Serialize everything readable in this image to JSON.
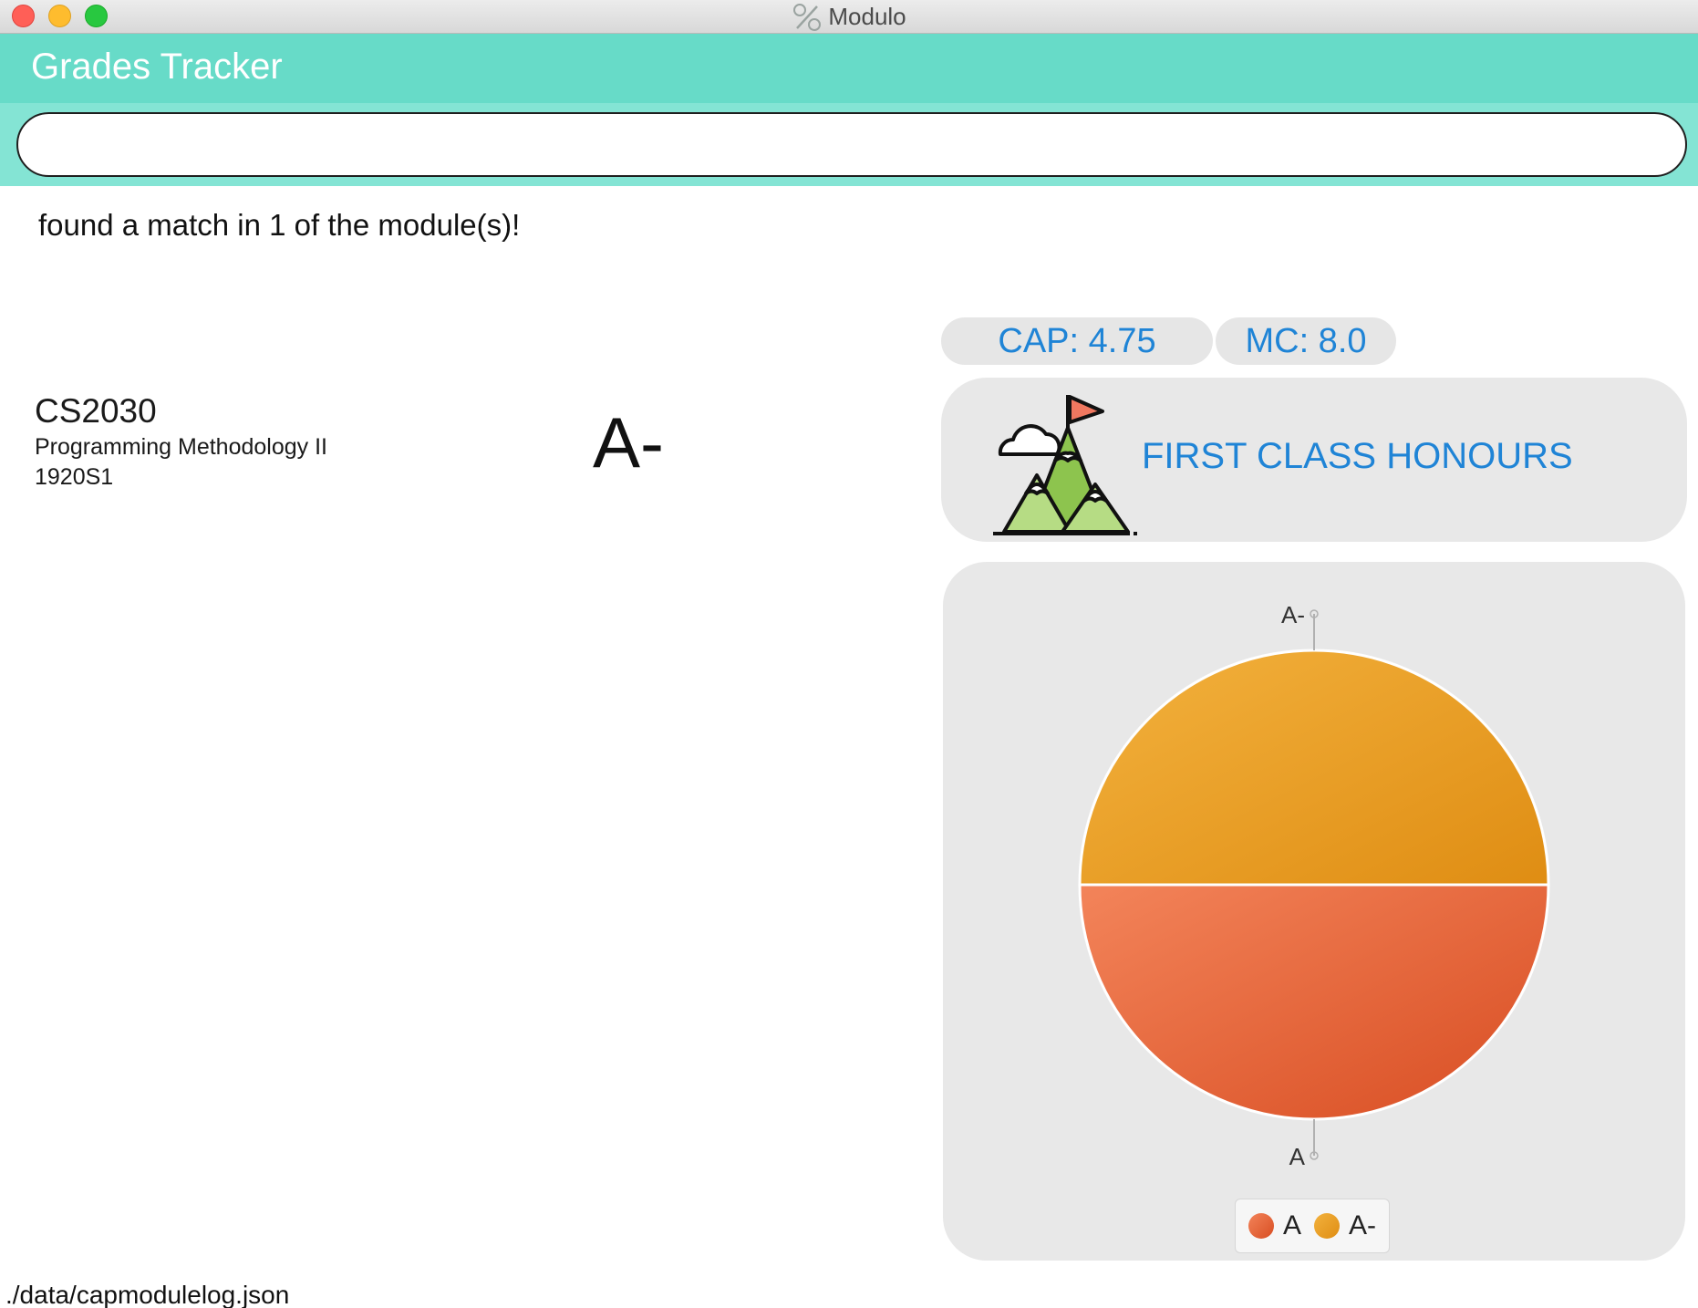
{
  "window": {
    "title": "Modulo",
    "app_icon": "percent-icon"
  },
  "header": {
    "title": "Grades Tracker"
  },
  "command": {
    "value": "",
    "placeholder": ""
  },
  "result": {
    "message": "found a match in 1 of the module(s)!"
  },
  "modules": [
    {
      "code": "CS2030",
      "name": "Programming Methodology II",
      "semester": "1920S1",
      "grade": "A-"
    }
  ],
  "stats": {
    "cap": "CAP: 4.75",
    "mc": "MC: 8.0",
    "honours": "FIRST CLASS HONOURS",
    "honours_icon": "mountain-flag-icon",
    "accent_color": "#1f84d6"
  },
  "chart_data": {
    "type": "pie",
    "slices": [
      {
        "label": "A",
        "value": 1,
        "color": "#e2592c"
      },
      {
        "label": "A-",
        "value": 1,
        "color": "#e8a126"
      }
    ],
    "legend": [
      "A",
      "A-"
    ],
    "legend_position": "bottom"
  },
  "footer": {
    "path": "./data/capmodulelog.json"
  },
  "colors": {
    "header_bg": "#67dbc8",
    "command_bar_bg": "#84e4d4",
    "panel_bg": "#e8e8e8"
  }
}
